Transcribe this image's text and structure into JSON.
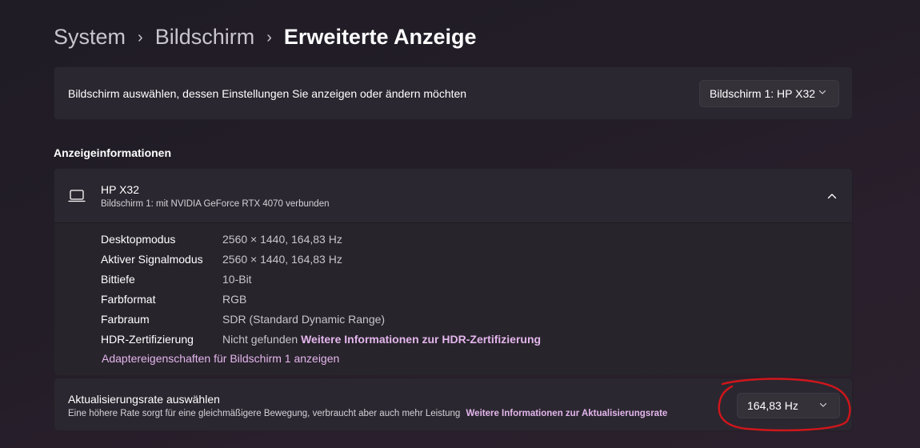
{
  "breadcrumb": {
    "items": [
      "System",
      "Bildschirm"
    ],
    "current": "Erweiterte Anzeige",
    "separator": "›"
  },
  "display_select": {
    "label": "Bildschirm auswählen, dessen Einstellungen Sie anzeigen oder ändern möchten",
    "selected": "Bildschirm 1: HP X32"
  },
  "display_info": {
    "section_title": "Anzeigeinformationen",
    "monitor_name": "HP X32",
    "monitor_subtitle": "Bildschirm 1: mit NVIDIA GeForce RTX 4070 verbunden",
    "rows": [
      {
        "key": "Desktopmodus",
        "value": "2560 × 1440, 164,83 Hz"
      },
      {
        "key": "Aktiver Signalmodus",
        "value": "2560 × 1440, 164,83 Hz"
      },
      {
        "key": "Bittiefe",
        "value": "10-Bit"
      },
      {
        "key": "Farbformat",
        "value": "RGB"
      },
      {
        "key": "Farbraum",
        "value": "SDR (Standard Dynamic Range)"
      },
      {
        "key": "HDR-Zertifizierung",
        "value": "Nicht gefunden",
        "link": "Weitere Informationen zur HDR-Zertifizierung"
      }
    ],
    "adapter_link": "Adaptereigenschaften für Bildschirm 1 anzeigen"
  },
  "refresh_rate": {
    "title": "Aktualisierungsrate auswählen",
    "description": "Eine höhere Rate sorgt für eine gleichmäßigere Bewegung, verbraucht aber auch mehr Leistung",
    "link": "Weitere Informationen zur Aktualisierungsrate",
    "selected": "164,83 Hz"
  },
  "icons": {
    "breadcrumb_separator": "chevron-right-icon",
    "dropdown": "chevron-down-icon",
    "monitor": "laptop-icon",
    "collapse": "chevron-up-icon"
  },
  "colors": {
    "accent_link": "#e3b6ec",
    "annotation": "#d0161b",
    "card_bg": "#2b2730"
  }
}
